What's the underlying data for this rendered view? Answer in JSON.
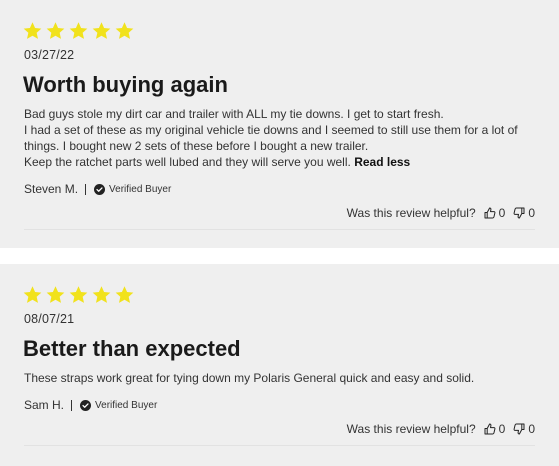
{
  "colors": {
    "star": "#f1e21c",
    "background": "#efefef"
  },
  "reviews": [
    {
      "rating": 5,
      "date": "03/27/22",
      "title": "Worth buying again",
      "body_lines": [
        "Bad guys stole my dirt car and trailer with ALL my tie downs. I get to start fresh.",
        "I had a set of these as my original vehicle tie downs and I seemed to still use them for a lot of",
        "things. I bought new 2 sets of these before I bought a new trailer.",
        "Keep the ratchet parts well lubed and they will serve you well."
      ],
      "read_less": "Read less",
      "author": "Steven M.",
      "verified_label": "Verified Buyer",
      "helpful_label": "Was this review helpful?",
      "up_count": "0",
      "down_count": "0"
    },
    {
      "rating": 5,
      "date": "08/07/21",
      "title": "Better than expected",
      "body_lines": [
        "These straps work great for tying down my Polaris General quick and easy and solid."
      ],
      "author": "Sam H.",
      "verified_label": "Verified Buyer",
      "helpful_label": "Was this review helpful?",
      "up_count": "0",
      "down_count": "0"
    }
  ]
}
